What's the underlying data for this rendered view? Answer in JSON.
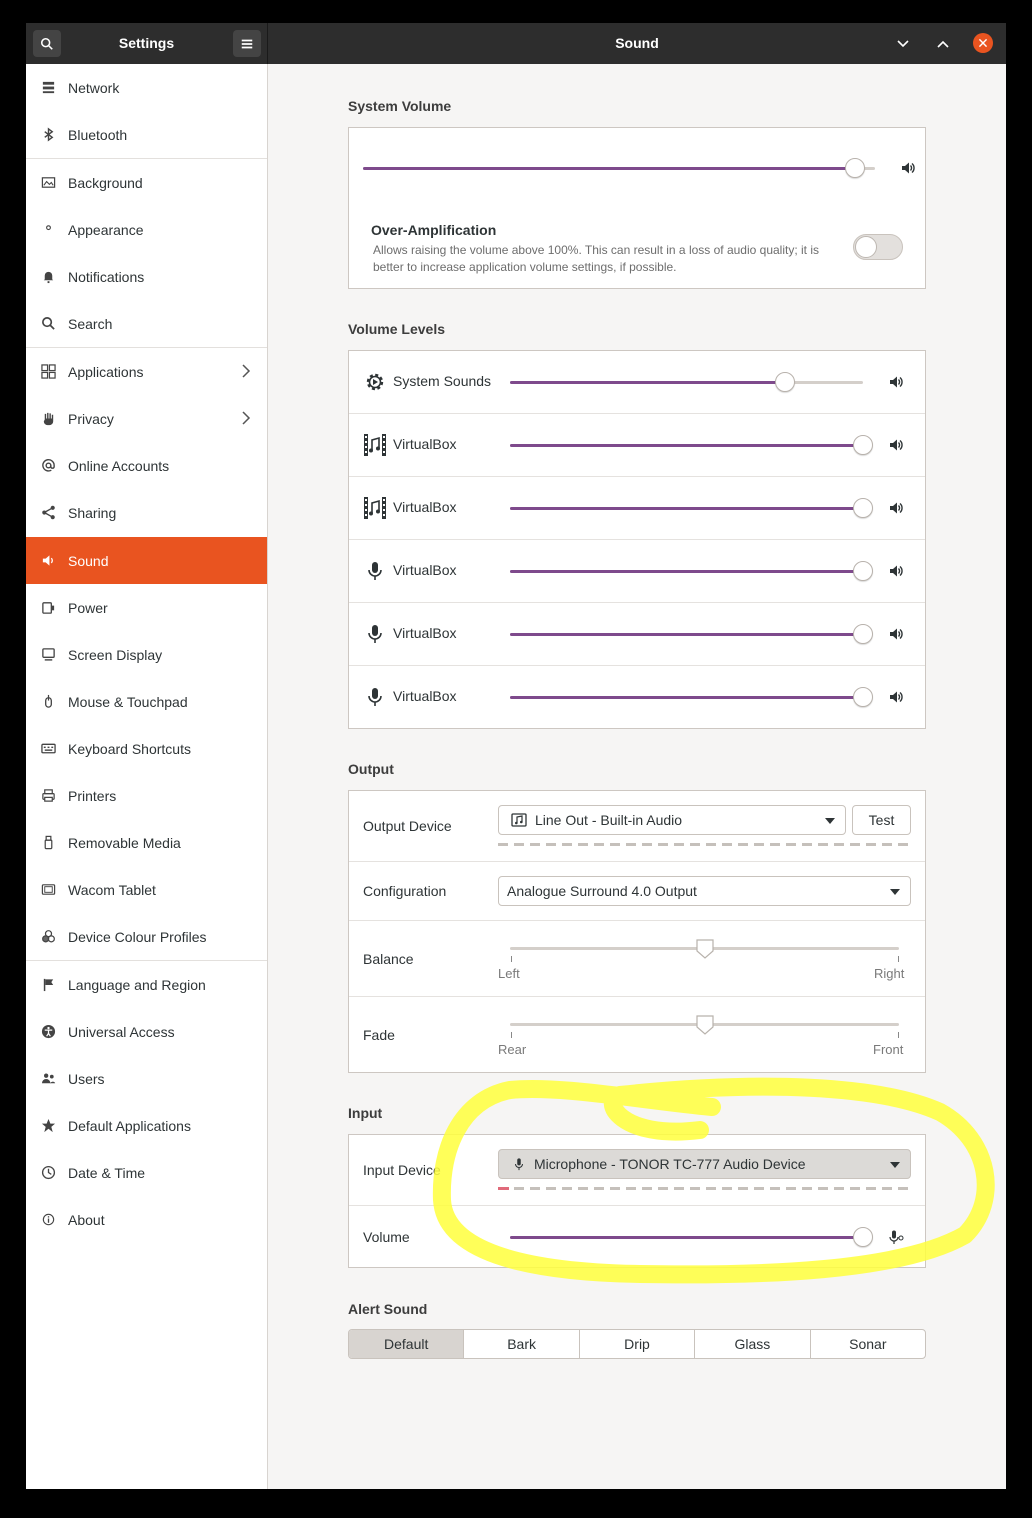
{
  "header": {
    "app_title": "Settings",
    "page_title": "Sound",
    "search_icon": "search-icon",
    "menu_icon": "hamburger-menu-icon"
  },
  "sidebar": {
    "items": [
      {
        "label": "Network",
        "icon": "network-icon"
      },
      {
        "label": "Bluetooth",
        "icon": "bluetooth-icon"
      },
      {
        "label": "Background",
        "icon": "background-icon"
      },
      {
        "label": "Appearance",
        "icon": "appearance-icon"
      },
      {
        "label": "Notifications",
        "icon": "bell-icon"
      },
      {
        "label": "Search",
        "icon": "search-icon"
      },
      {
        "label": "Applications",
        "icon": "grid-icon"
      },
      {
        "label": "Privacy",
        "icon": "hand-icon"
      },
      {
        "label": "Online Accounts",
        "icon": "at-icon"
      },
      {
        "label": "Sharing",
        "icon": "share-icon"
      },
      {
        "label": "Sound",
        "icon": "speaker-icon"
      },
      {
        "label": "Power",
        "icon": "power-icon"
      },
      {
        "label": "Screen Display",
        "icon": "display-icon"
      },
      {
        "label": "Mouse & Touchpad",
        "icon": "mouse-icon"
      },
      {
        "label": "Keyboard Shortcuts",
        "icon": "keyboard-icon"
      },
      {
        "label": "Printers",
        "icon": "printer-icon"
      },
      {
        "label": "Removable Media",
        "icon": "usb-icon"
      },
      {
        "label": "Wacom Tablet",
        "icon": "tablet-icon"
      },
      {
        "label": "Device Colour Profiles",
        "icon": "color-icon"
      },
      {
        "label": "Language and Region",
        "icon": "flag-icon"
      },
      {
        "label": "Universal Access",
        "icon": "accessibility-icon"
      },
      {
        "label": "Users",
        "icon": "users-icon"
      },
      {
        "label": "Default Applications",
        "icon": "star-icon"
      },
      {
        "label": "Date & Time",
        "icon": "clock-icon"
      },
      {
        "label": "About",
        "icon": "info-icon"
      }
    ],
    "active": "Sound"
  },
  "system_volume": {
    "title": "System Volume",
    "level": 0.96,
    "over_amp_title": "Over-Amplification",
    "over_amp_desc_line1": "Allows raising the volume above 100%. This can result in a loss of audio quality; it is",
    "over_amp_desc_line2": "better to increase application volume settings, if possible.",
    "over_amp_enabled": false
  },
  "volume_levels": {
    "title": "Volume Levels",
    "rows": [
      {
        "label": "System Sounds",
        "icon": "gear-icon",
        "level": 0.78
      },
      {
        "label": "VirtualBox",
        "icon": "music-film-icon",
        "level": 1.0
      },
      {
        "label": "VirtualBox",
        "icon": "music-film-icon",
        "level": 1.0
      },
      {
        "label": "VirtualBox",
        "icon": "microphone-icon",
        "level": 1.0
      },
      {
        "label": "VirtualBox",
        "icon": "microphone-icon",
        "level": 1.0
      },
      {
        "label": "VirtualBox",
        "icon": "microphone-icon",
        "level": 1.0
      }
    ]
  },
  "output": {
    "title": "Output",
    "device_label": "Output Device",
    "device_value": "Line Out - Built-in Audio",
    "test_label": "Test",
    "config_label": "Configuration",
    "config_value": "Analogue Surround 4.0 Output",
    "balance_label": "Balance",
    "balance_left": "Left",
    "balance_right": "Right",
    "balance_value": 0.5,
    "fade_label": "Fade",
    "fade_rear": "Rear",
    "fade_front": "Front",
    "fade_value": 0.5
  },
  "input": {
    "title": "Input",
    "device_label": "Input Device",
    "device_value": "Microphone - TONOR TC-777 Audio Device",
    "volume_label": "Volume",
    "volume_level": 1.0
  },
  "alert_sound": {
    "title": "Alert Sound",
    "options": [
      "Default",
      "Bark",
      "Drip",
      "Glass",
      "Sonar"
    ],
    "selected": "Default"
  },
  "colors": {
    "accent": "#e95420",
    "slider_fill": "#7e4a8c",
    "highlight": "#ffff3c"
  }
}
